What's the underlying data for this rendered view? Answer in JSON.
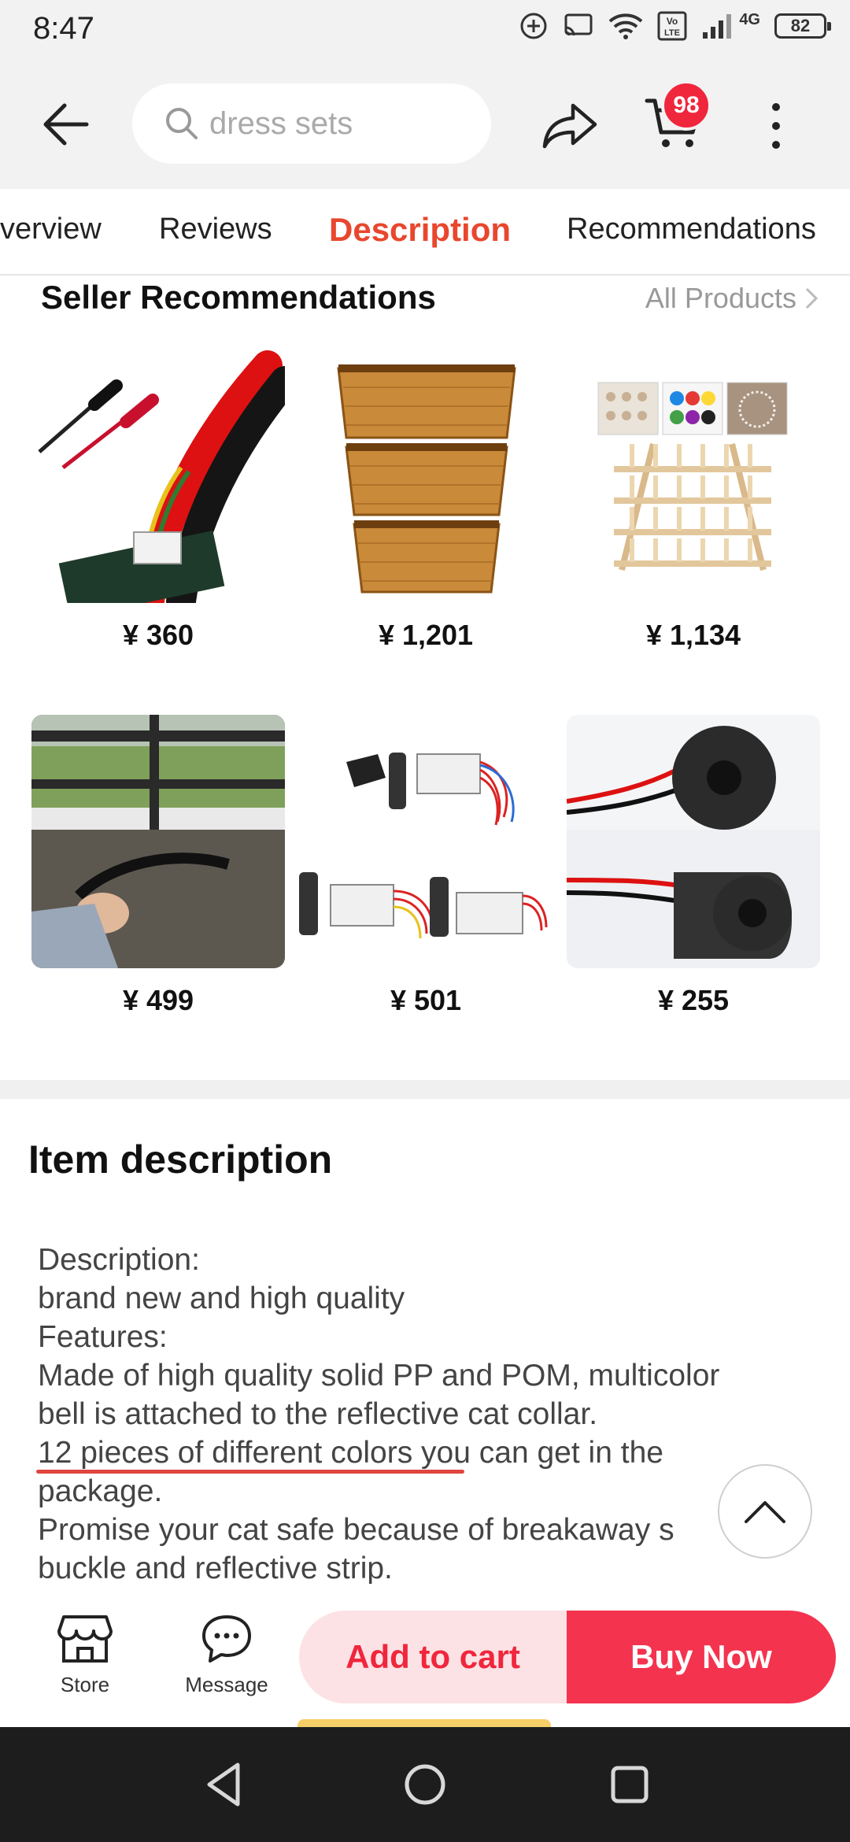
{
  "status_bar": {
    "time": "8:47",
    "battery": "82",
    "network": "4G"
  },
  "top_bar": {
    "search_placeholder": "dress sets",
    "cart_count": "98",
    "icons": [
      "back-arrow-icon",
      "search-icon",
      "share-icon",
      "cart-icon",
      "more-vertical-icon"
    ]
  },
  "tabs": [
    {
      "label": "verview",
      "active": false
    },
    {
      "label": "Reviews",
      "active": false
    },
    {
      "label": "Description",
      "active": true
    },
    {
      "label": "Recommendations",
      "active": false
    }
  ],
  "seller_recommendations": {
    "title": "Seller Recommendations",
    "all_link": "All Products",
    "products": [
      {
        "price": "¥ 360",
        "image": "test-probe-leads"
      },
      {
        "price": "¥ 1,201",
        "image": "rattan-baskets"
      },
      {
        "price": "¥ 1,134",
        "image": "thread-spool-rack"
      },
      {
        "price": "¥ 499",
        "image": "window-sealing-tool"
      },
      {
        "price": "¥ 501",
        "image": "remote-switch-modules"
      },
      {
        "price": "¥ 255",
        "image": "current-transformer-rings"
      }
    ]
  },
  "item_description": {
    "title": "Item description",
    "lines": [
      "Description:",
      "brand new and high quality",
      "Features:",
      "Made of high quality solid PP and POM, multicolor",
      "bell is attached to the reflective cat collar.",
      "12 pieces of different colors you can get in the",
      "package.",
      "Promise your cat safe because of breakaway s",
      "buckle and reflective strip."
    ]
  },
  "action_bar": {
    "store_label": "Store",
    "message_label": "Message",
    "add_to_cart": "Add to cart",
    "buy_now": "Buy Now"
  },
  "colors": {
    "accent": "#e8472e",
    "buy_now": "#f4334f",
    "add_to_cart_bg": "#fde2e5",
    "badge": "#f0263c"
  }
}
